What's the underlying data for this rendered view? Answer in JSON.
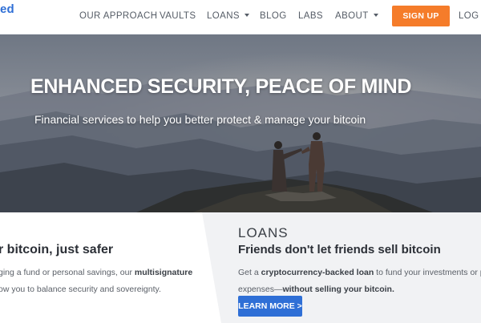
{
  "brand": {
    "logo_fragment": "ed"
  },
  "nav": {
    "our_approach": "OUR APPROACH",
    "vaults": "VAULTS",
    "loans": "LOANS",
    "blog": "BLOG",
    "labs": "LABS",
    "about": "ABOUT",
    "signup": "SIGN UP",
    "login": "LOG IN"
  },
  "hero": {
    "title": "ENHANCED SECURITY, PEACE OF MIND",
    "subtitle": "Financial services to help you better protect & manage your bitcoin"
  },
  "vaults_section": {
    "heading": "r bitcoin, just safer",
    "body_line1_start": "ging a fund or personal savings, our ",
    "body_line1_bold": "multisignature",
    "body_line2": "ow you to balance security and sovereignty."
  },
  "loans_section": {
    "label": "LOANS",
    "heading": "Friends don't let friends sell bitcoin",
    "body_line1_start": "Get a ",
    "body_line1_bold": "cryptocurrency-backed loan",
    "body_line1_end": " to fund your investments or pay y",
    "body_line2_start": "expenses—",
    "body_line2_bold": "without selling your bitcoin.",
    "cta": "LEARN MORE >"
  },
  "colors": {
    "accent_orange": "#f57c2a",
    "accent_blue": "#2f6fd6",
    "panel_gray": "#f1f2f4"
  }
}
